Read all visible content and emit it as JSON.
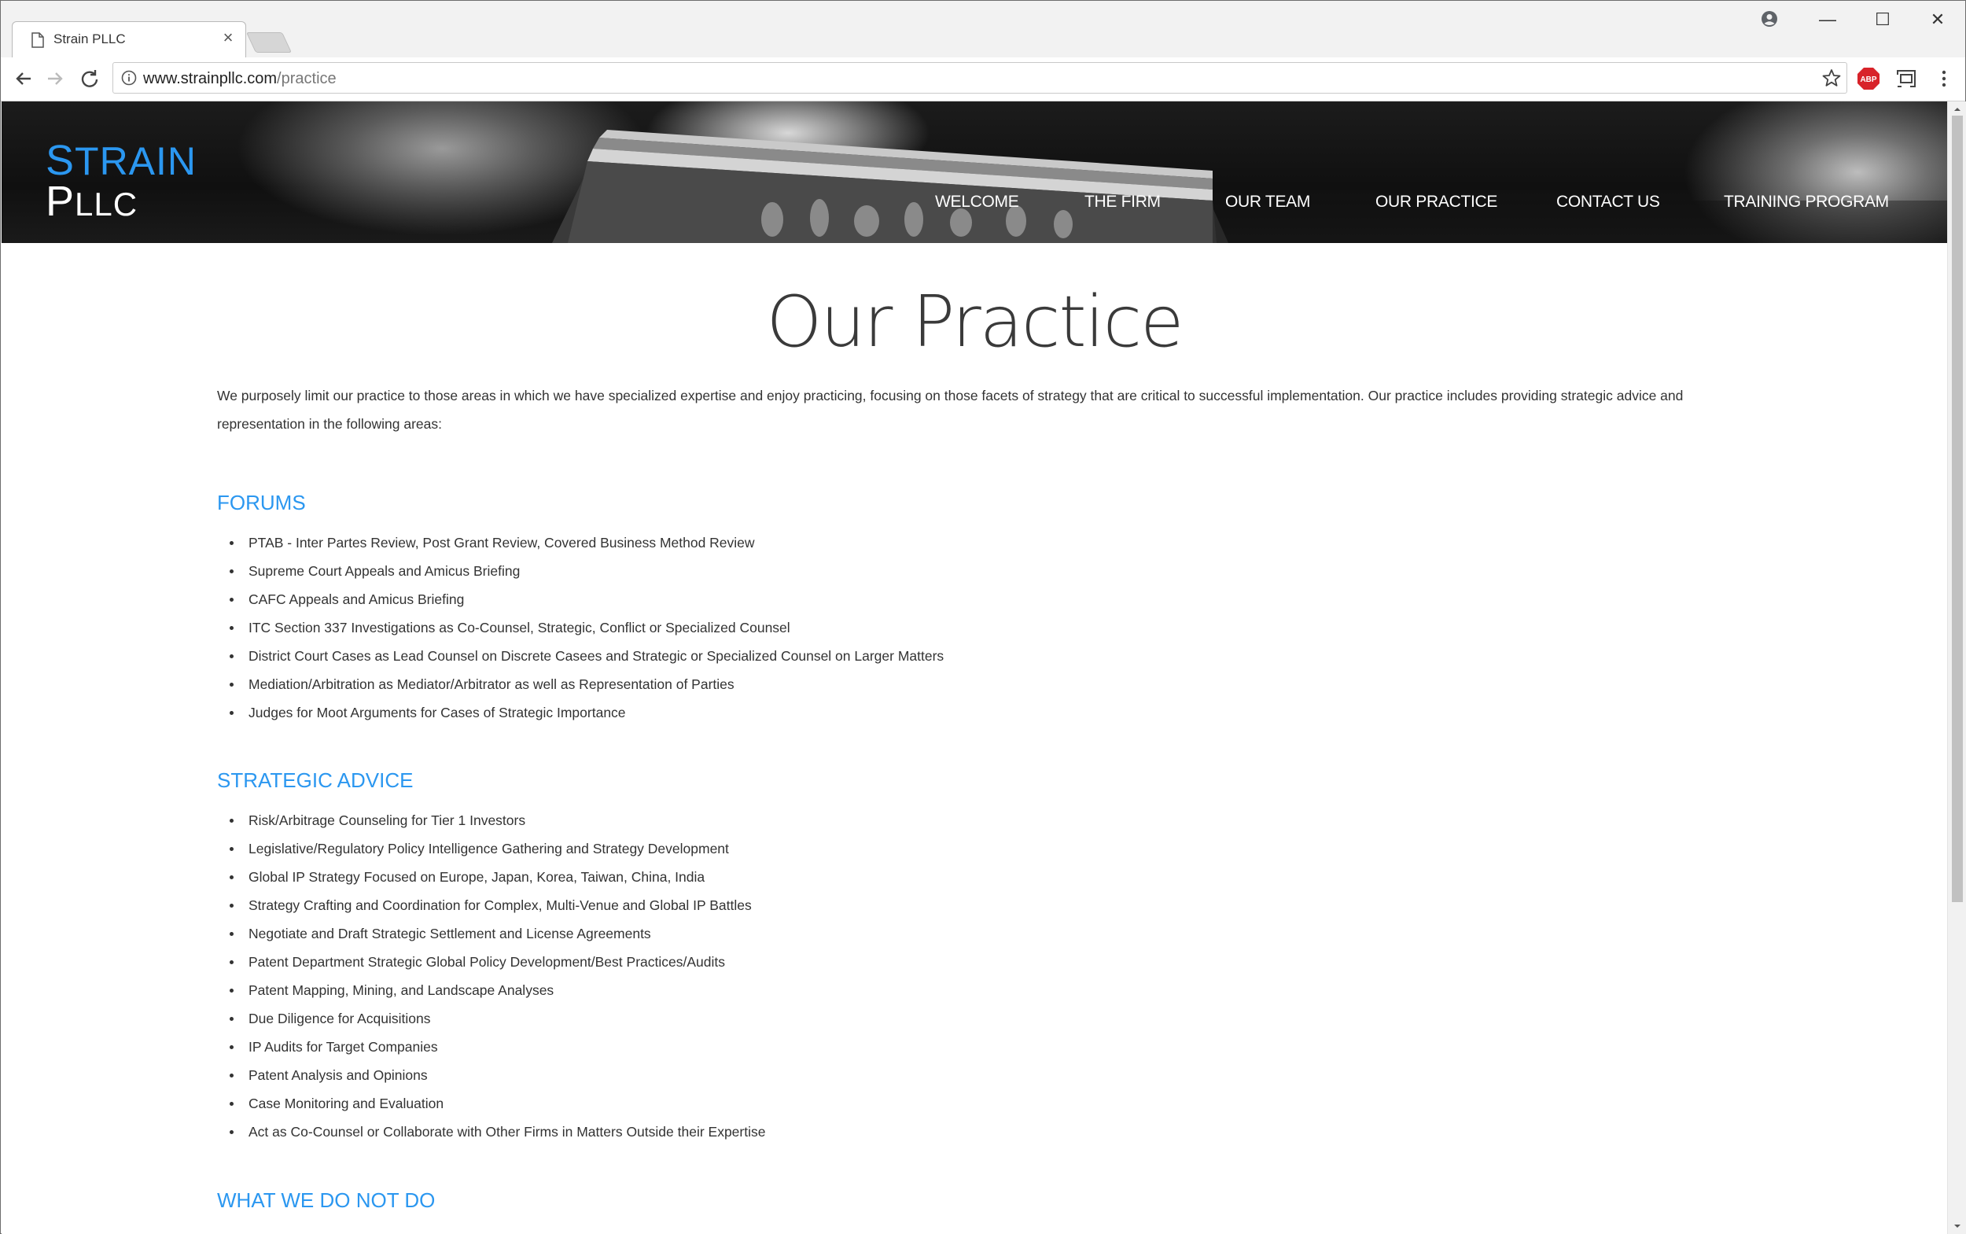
{
  "browser": {
    "tab_title": "Strain PLLC",
    "tab_close": "×",
    "url_host": "www.strainpllc.com",
    "url_path": "/practice",
    "window_controls": {
      "minimize": "—",
      "maximize": "☐",
      "close": "✕"
    },
    "abp_label": "ABP"
  },
  "site": {
    "logo_line1_initial": "S",
    "logo_line1_rest": "TRAIN",
    "logo_line2_initial": "P",
    "logo_line2_rest": "LLC",
    "nav": [
      "WELCOME",
      "THE FIRM",
      "OUR TEAM",
      "OUR PRACTICE",
      "CONTACT US",
      "TRAINING PROGRAM"
    ]
  },
  "page": {
    "title": "Our Practice",
    "intro": "We purposely limit our practice to those areas in which we have specialized expertise and enjoy practicing, focusing on those facets of strategy that are critical to successful implementation. Our practice includes providing strategic advice and representation in the following areas:",
    "sections": [
      {
        "heading": "FORUMS",
        "items": [
          "PTAB - Inter Partes Review, Post Grant Review, Covered Business Method Review",
          "Supreme Court Appeals and Amicus Briefing",
          "CAFC Appeals and Amicus Briefing",
          "ITC Section 337 Investigations as Co-Counsel, Strategic, Conflict or Specialized Counsel",
          "District Court Cases as Lead Counsel on Discrete Casees and Strategic or Specialized Counsel on Larger Matters",
          "Mediation/Arbitration as Mediator/Arbitrator as well as Representation of Parties",
          "Judges for Moot Arguments for Cases of Strategic Importance"
        ]
      },
      {
        "heading": "STRATEGIC ADVICE",
        "items": [
          "Risk/Arbitrage Counseling for Tier 1 Investors",
          "Legislative/Regulatory Policy Intelligence Gathering and Strategy Development",
          "Global IP Strategy Focused on Europe, Japan, Korea, Taiwan, China, India",
          "Strategy Crafting and Coordination for Complex, Multi-Venue and Global IP Battles",
          "Negotiate and Draft Strategic Settlement and License Agreements",
          "Patent Department Strategic Global Policy Development/Best Practices/Audits",
          "Patent Mapping, Mining, and Landscape Analyses",
          "Due Diligence for Acquisitions",
          "IP Audits for Target Companies",
          "Patent Analysis and Opinions",
          "Case Monitoring and Evaluation",
          "Act as Co-Counsel or Collaborate with Other Firms in Matters Outside their Expertise"
        ]
      },
      {
        "heading": "WHAT WE DO NOT DO",
        "items": []
      }
    ]
  },
  "colors": {
    "accent": "#2b97f0",
    "text": "#333333",
    "hero": "#141414"
  }
}
